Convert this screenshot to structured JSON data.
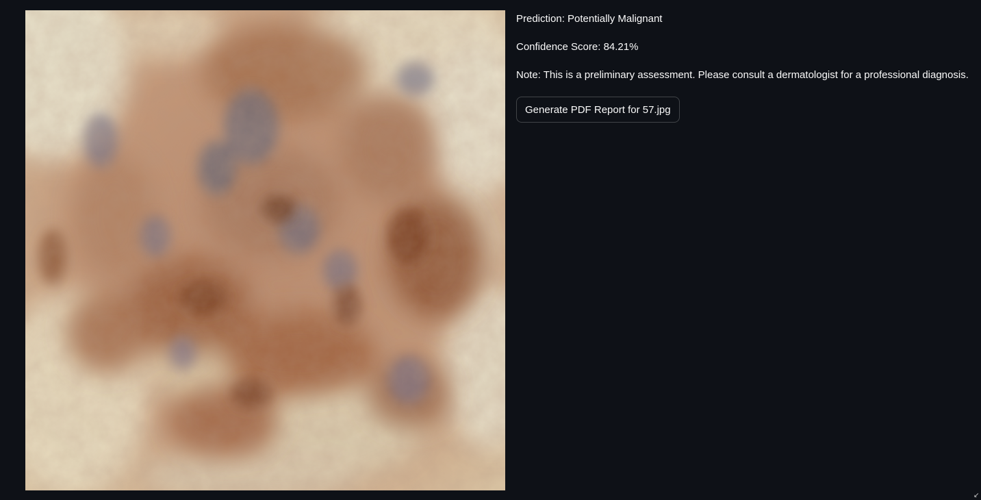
{
  "image": {
    "alt": "57.jpg"
  },
  "results": {
    "prediction": "Prediction: Potentially Malignant",
    "confidence": "Confidence Score: 84.21%",
    "note": "Note: This is a preliminary assessment. Please consult a dermatologist for a professional diagnosis."
  },
  "actions": {
    "report_button_label": "Generate PDF Report for 57.jpg"
  },
  "colors": {
    "background": "#0e1117",
    "text": "#fafafa",
    "button_border": "#3a3d45"
  }
}
